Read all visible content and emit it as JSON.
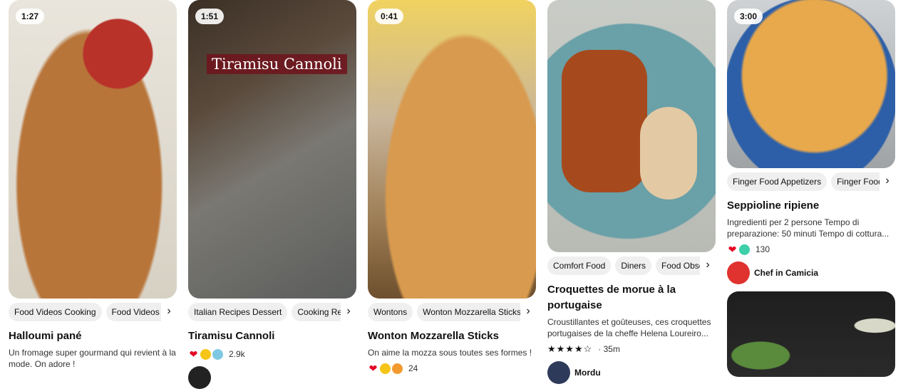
{
  "pins": [
    {
      "duration": "1:27",
      "tags": [
        "Food Videos Cooking",
        "Food Videos Desserts"
      ],
      "title": "Halloumi pané",
      "description": "Un fromage super gourmand qui revient à la mode. On adore !"
    },
    {
      "duration": "1:51",
      "overlay": "Tiramisu Cannoli",
      "tags": [
        "Italian Recipes Dessert",
        "Cooking Recipes"
      ],
      "title": "Tiramisu Cannoli",
      "count": "2.9k"
    },
    {
      "duration": "0:41",
      "tags": [
        "Wontons",
        "Wonton Mozzarella Sticks"
      ],
      "title": "Wonton Mozzarella Sticks",
      "description": "On aime la mozza sous toutes ses formes !",
      "count": "24"
    },
    {
      "tags": [
        "Comfort Food",
        "Diners",
        "Food Obsession"
      ],
      "title": "Croquettes de morue à la portugaise",
      "description": "Croustillantes et goûteuses, ces croquettes portugaises de la cheffe Helena Loureiro...",
      "rating_stars": 3.5,
      "rating_text": "· 35m",
      "author": "Mordu"
    },
    {
      "duration": "3:00",
      "tags": [
        "Finger Food Appetizers",
        "Finger Foods"
      ],
      "title": "Seppioline ripiene",
      "description": "Ingredienti per 2 persone Tempo di preparazione: 50 minuti Tempo di cottura...",
      "count": "130",
      "author": "Chef in Camicia"
    }
  ],
  "icons": {
    "chevron": "›",
    "heart": "❤",
    "wow": "😮",
    "good": "😊",
    "star": "★"
  }
}
